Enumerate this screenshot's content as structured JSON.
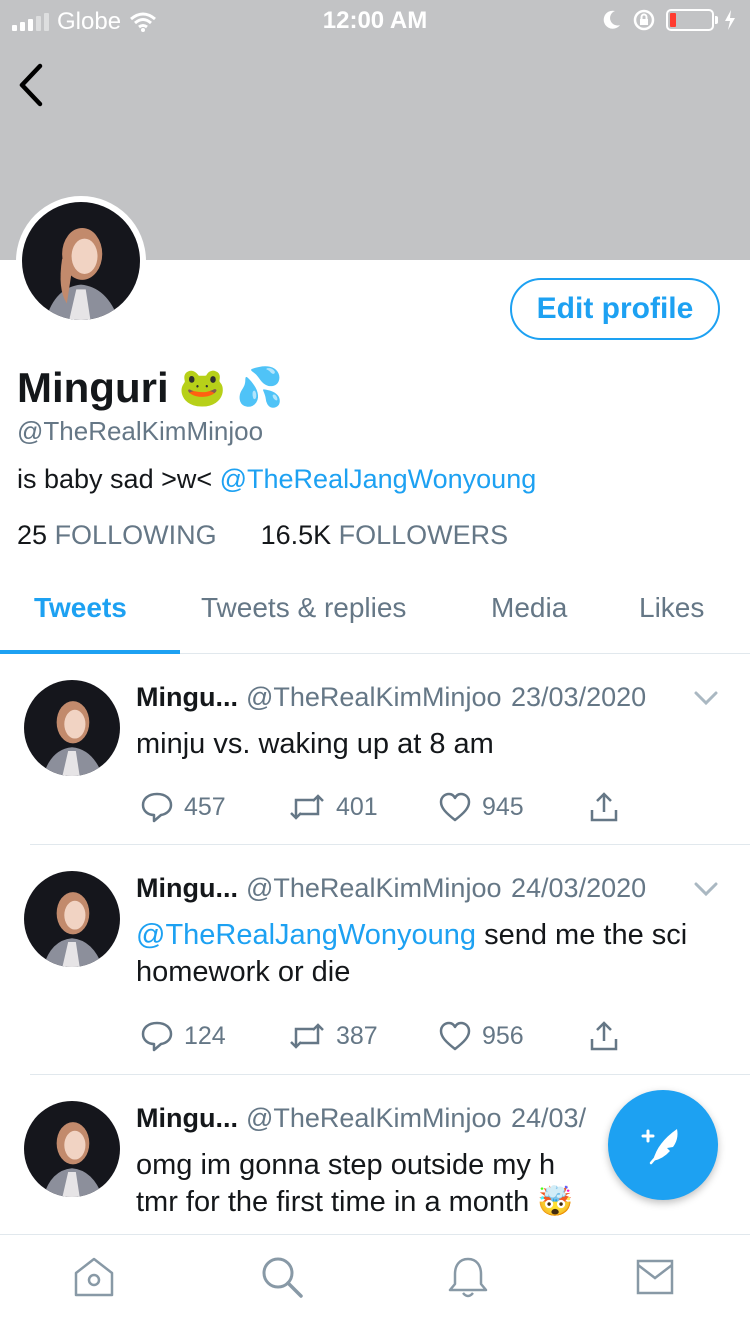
{
  "status_bar": {
    "carrier": "Globe",
    "time": "12:00 AM",
    "icons": [
      "signal-icon",
      "wifi-icon",
      "moon-icon",
      "rotation-lock-icon",
      "battery-icon",
      "charging-icon"
    ],
    "battery_level": 0.1
  },
  "header": {
    "banner_color": "#c2c3c5",
    "back_icon": "chevron-left-icon"
  },
  "profile": {
    "edit_label": "Edit profile",
    "display_name": "Minguri",
    "name_emojis": [
      "🐸",
      "💦"
    ],
    "handle": "@TheRealKimMinjoo",
    "bio_text": "is baby sad >w< ",
    "bio_mention": "@TheRealJangWonyoung",
    "following_count": "25",
    "following_label": "FOLLOWING",
    "followers_count": "16.5K",
    "followers_label": "FOLLOWERS"
  },
  "tabs": [
    {
      "label": "Tweets",
      "active": true
    },
    {
      "label": "Tweets & replies",
      "active": false
    },
    {
      "label": "Media",
      "active": false
    },
    {
      "label": "Likes",
      "active": false
    }
  ],
  "tweets": [
    {
      "name": "Mingu...",
      "handle": "@TheRealKimMinjoo",
      "date": "23/03/2020",
      "mention": "",
      "text": "minju vs. waking up at 8 am",
      "replies": "457",
      "retweets": "401",
      "likes": "945"
    },
    {
      "name": "Mingu...",
      "handle": "@TheRealKimMinjoo",
      "date": "24/03/2020",
      "mention": "@TheRealJangWonyoung",
      "text": " send me the sci homework or die",
      "replies": "124",
      "retweets": "387",
      "likes": "956"
    },
    {
      "name": "Mingu...",
      "handle": "@TheRealKimMinjoo",
      "date": "24/03/",
      "mention": "",
      "text": "omg im gonna step outside my h",
      "text_line2": "tmr for the first time in a month 🤯"
    }
  ],
  "compose": {
    "icon": "compose-feather-icon"
  },
  "bottom_nav": [
    "home-icon",
    "search-icon",
    "notifications-bell-icon",
    "messages-envelope-icon"
  ],
  "colors": {
    "accent": "#1da1f2",
    "secondary_text": "#657786",
    "divider": "#e1e8ed",
    "low_battery": "#ff3b30"
  }
}
